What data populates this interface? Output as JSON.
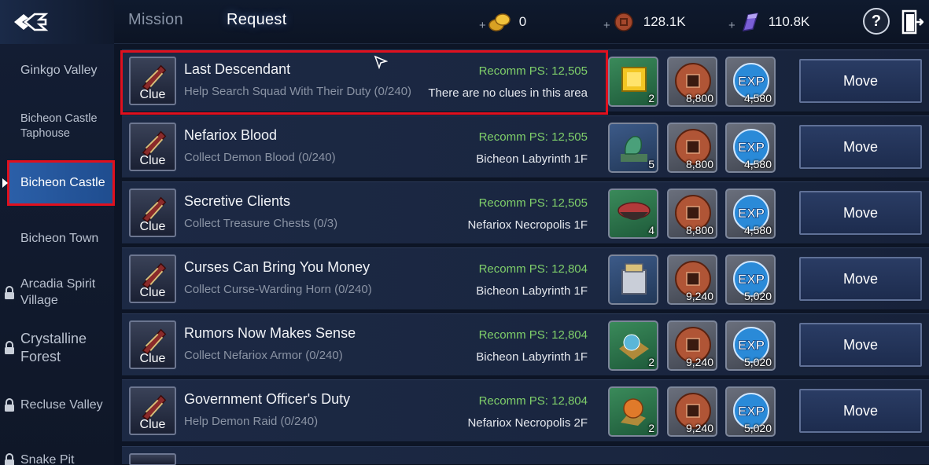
{
  "header": {
    "tabs": [
      {
        "label": "Mission",
        "active": false
      },
      {
        "label": "Request",
        "active": true
      }
    ],
    "currencies": [
      {
        "icon": "gold-coins-icon",
        "plus": "+",
        "value": "0"
      },
      {
        "icon": "copper-coin-icon",
        "plus": "+",
        "value": "128.1K"
      },
      {
        "icon": "purple-crystal-icon",
        "plus": "+",
        "value": "110.8K"
      }
    ],
    "help_label": "?"
  },
  "sidebar": {
    "items": [
      {
        "label": "Ginkgo Valley",
        "locked": false,
        "active": false
      },
      {
        "label": "Bicheon Castle Taphouse",
        "locked": false,
        "active": false
      },
      {
        "label": "Bicheon Castle",
        "locked": false,
        "active": true
      },
      {
        "label": "Bicheon Town",
        "locked": false,
        "active": false
      },
      {
        "label": "Arcadia Spirit Village",
        "locked": true,
        "active": false
      },
      {
        "label": "Crystalline Forest",
        "locked": true,
        "active": false
      },
      {
        "label": "Recluse Valley",
        "locked": true,
        "active": false
      },
      {
        "label": "Snake Pit",
        "locked": true,
        "active": false
      }
    ]
  },
  "requests": [
    {
      "clue_label": "Clue",
      "title": "Last Descendant",
      "desc": "Help Search Squad With Their Duty (0/240)",
      "ps": "Recomm PS: 12,505",
      "location": "There are no clues in this area",
      "item_icon": "gold-cube-icon",
      "item_count": "2",
      "copper": "8,800",
      "exp": "4,580",
      "move_label": "Move"
    },
    {
      "clue_label": "Clue",
      "title": "Nefariox Blood",
      "desc": "Collect Demon Blood (0/240)",
      "ps": "Recomm PS: 12,505",
      "location": "Bicheon Labyrinth 1F",
      "item_icon": "jade-dragon-statue-icon",
      "item_count": "5",
      "copper": "8,800",
      "exp": "4,580",
      "move_label": "Move"
    },
    {
      "clue_label": "Clue",
      "title": "Secretive Clients",
      "desc": "Collect Treasure Chests (0/3)",
      "ps": "Recomm PS: 12,505",
      "location": "Nefariox Necropolis 1F",
      "item_icon": "bowl-icon",
      "item_count": "4",
      "copper": "8,800",
      "exp": "4,580",
      "move_label": "Move"
    },
    {
      "clue_label": "Clue",
      "title": "Curses Can Bring You Money",
      "desc": "Collect Curse-Warding Horn (0/240)",
      "ps": "Recomm PS: 12,804",
      "location": "Bicheon Labyrinth 1F",
      "item_icon": "silver-box-icon",
      "item_count": "",
      "copper": "9,240",
      "exp": "5,020",
      "move_label": "Move"
    },
    {
      "clue_label": "Clue",
      "title": "Rumors Now Makes Sense",
      "desc": "Collect Nefariox Armor (0/240)",
      "ps": "Recomm PS: 12,804",
      "location": "Bicheon Labyrinth 1F",
      "item_icon": "blue-orb-icon",
      "item_count": "2",
      "copper": "9,240",
      "exp": "5,020",
      "move_label": "Move"
    },
    {
      "clue_label": "Clue",
      "title": "Government Officer's Duty",
      "desc": "Help Demon Raid (0/240)",
      "ps": "Recomm PS: 12,804",
      "location": "Nefariox Necropolis 2F",
      "item_icon": "orange-orb-icon",
      "item_count": "2",
      "copper": "9,240",
      "exp": "5,020",
      "move_label": "Move"
    }
  ],
  "colors": {
    "highlight": "#e0101e",
    "ps_green": "#7fcf6a",
    "active_tab_bg": "#2b5fa8"
  }
}
